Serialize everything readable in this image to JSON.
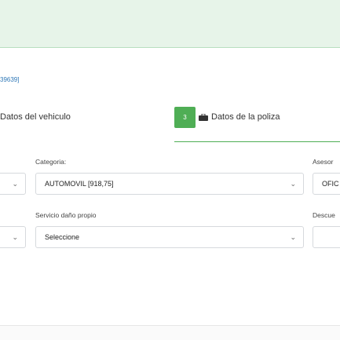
{
  "reference": "39639]",
  "steps": {
    "vehicle": {
      "label": "Datos del vehiculo"
    },
    "policy": {
      "number": "3",
      "label": "Datos de la poliza"
    }
  },
  "fields": {
    "categoria": {
      "label": "Categoria:",
      "value": "AUTOMOVIL [918,75]"
    },
    "asesor": {
      "label": "Asesor",
      "value": "OFIC"
    },
    "servicio": {
      "label": "Servicio daño propio",
      "value": "Seleccione"
    },
    "descuento": {
      "label": "Descue"
    }
  },
  "icons": {
    "chevron": "⌄",
    "policy_icon": "briefcase-icon"
  },
  "colors": {
    "accent": "#4fae55",
    "link": "#2f78b7",
    "alert_bg": "#e7f4e9"
  }
}
